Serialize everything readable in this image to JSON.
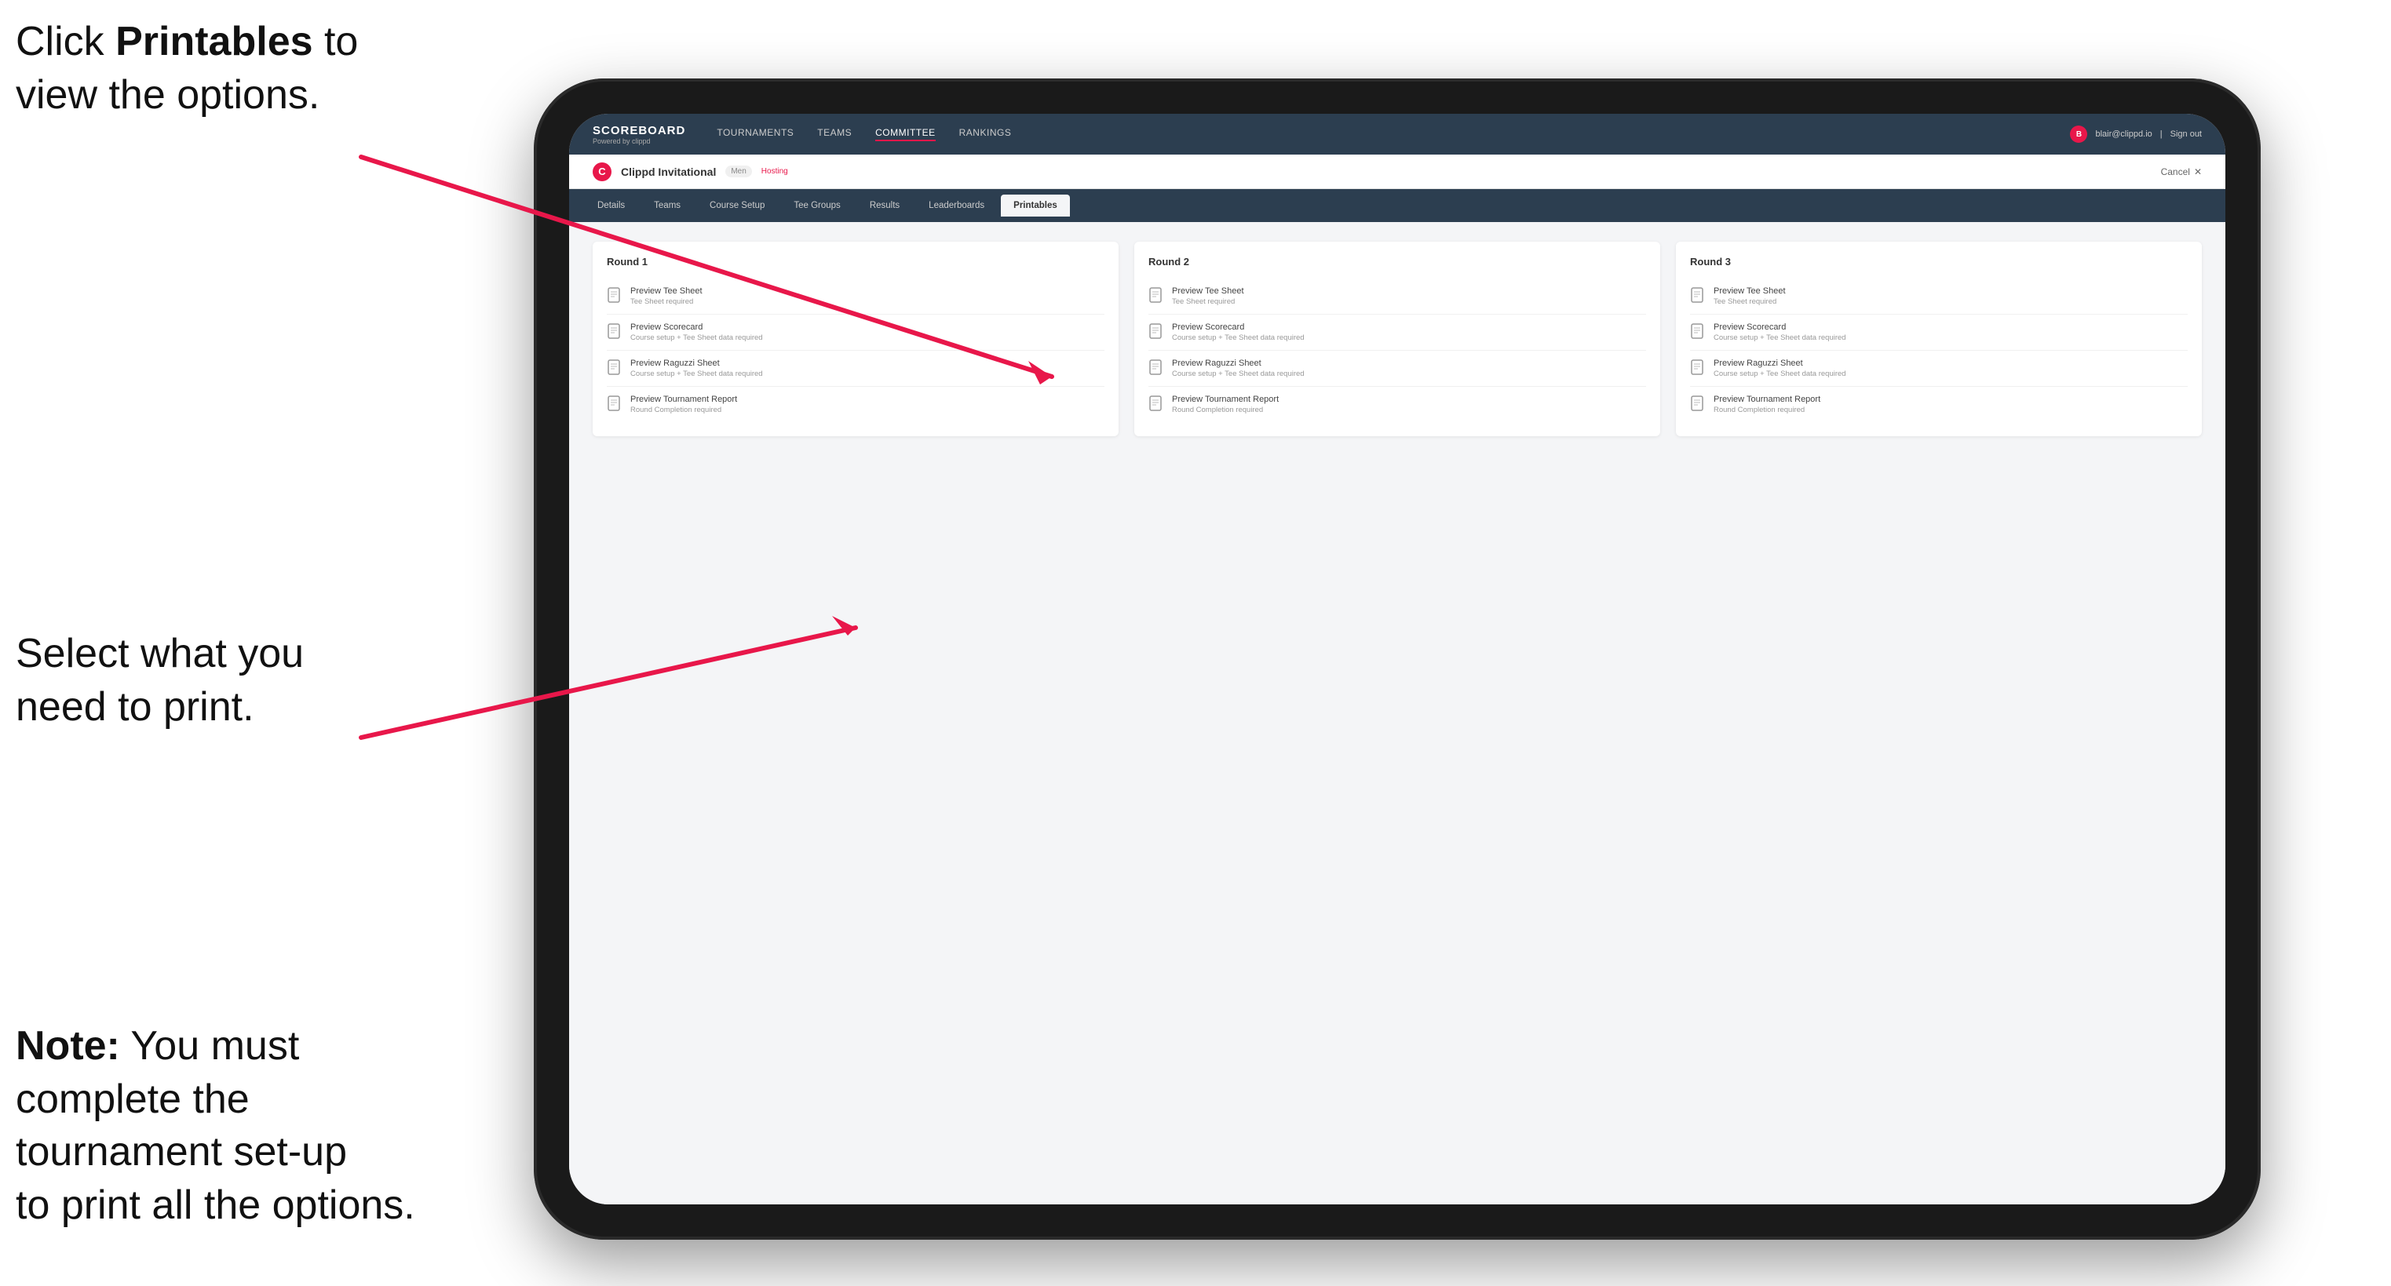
{
  "annotations": {
    "top_line1": "Click ",
    "top_bold": "Printables",
    "top_line2": " to",
    "top_line3": "view the options.",
    "middle_line1": "Select what you",
    "middle_line2": "need to print.",
    "bottom_note": "Note:",
    "bottom_text": " You must",
    "bottom_line2": "complete the",
    "bottom_line3": "tournament set-up",
    "bottom_line4": "to print all the options."
  },
  "nav": {
    "logo_title": "SCOREBOARD",
    "logo_subtitle": "Powered by clippd",
    "links": [
      "TOURNAMENTS",
      "TEAMS",
      "COMMITTEE",
      "RANKINGS"
    ],
    "active_link": "COMMITTEE",
    "user_email": "blair@clippd.io",
    "sign_out": "Sign out",
    "user_initial": "B"
  },
  "tournament": {
    "name": "Clippd Invitational",
    "badge": "Men",
    "hosting": "Hosting",
    "cancel": "Cancel"
  },
  "tabs": {
    "items": [
      "Details",
      "Teams",
      "Course Setup",
      "Tee Groups",
      "Results",
      "Leaderboards",
      "Printables"
    ],
    "active": "Printables"
  },
  "rounds": [
    {
      "title": "Round 1",
      "items": [
        {
          "label": "Preview Tee Sheet",
          "sub": "Tee Sheet required"
        },
        {
          "label": "Preview Scorecard",
          "sub": "Course setup + Tee Sheet data required"
        },
        {
          "label": "Preview Raguzzi Sheet",
          "sub": "Course setup + Tee Sheet data required"
        },
        {
          "label": "Preview Tournament Report",
          "sub": "Round Completion required"
        }
      ]
    },
    {
      "title": "Round 2",
      "items": [
        {
          "label": "Preview Tee Sheet",
          "sub": "Tee Sheet required"
        },
        {
          "label": "Preview Scorecard",
          "sub": "Course setup + Tee Sheet data required"
        },
        {
          "label": "Preview Raguzzi Sheet",
          "sub": "Course setup + Tee Sheet data required"
        },
        {
          "label": "Preview Tournament Report",
          "sub": "Round Completion required"
        }
      ]
    },
    {
      "title": "Round 3",
      "items": [
        {
          "label": "Preview Tee Sheet",
          "sub": "Tee Sheet required"
        },
        {
          "label": "Preview Scorecard",
          "sub": "Course setup + Tee Sheet data required"
        },
        {
          "label": "Preview Raguzzi Sheet",
          "sub": "Course setup + Tee Sheet data required"
        },
        {
          "label": "Preview Tournament Report",
          "sub": "Round Completion required"
        }
      ]
    }
  ]
}
